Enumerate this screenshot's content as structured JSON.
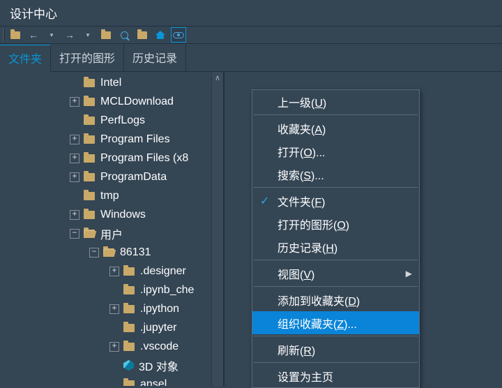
{
  "title": "设计中心",
  "tabs": [
    "文件夹",
    "打开的图形",
    "历史记录"
  ],
  "activeTab": 0,
  "tree": [
    {
      "ind": 100,
      "exp": "",
      "icon": "folder",
      "label": "Intel"
    },
    {
      "ind": 100,
      "exp": "+",
      "icon": "folder",
      "label": "MCLDownload"
    },
    {
      "ind": 100,
      "exp": "",
      "icon": "folder",
      "label": "PerfLogs"
    },
    {
      "ind": 100,
      "exp": "+",
      "icon": "folder",
      "label": "Program Files"
    },
    {
      "ind": 100,
      "exp": "+",
      "icon": "folder",
      "label": "Program Files (x8"
    },
    {
      "ind": 100,
      "exp": "+",
      "icon": "folder",
      "label": "ProgramData"
    },
    {
      "ind": 100,
      "exp": "",
      "icon": "folder",
      "label": "tmp"
    },
    {
      "ind": 100,
      "exp": "+",
      "icon": "folder",
      "label": "Windows"
    },
    {
      "ind": 100,
      "exp": "−",
      "icon": "folder-open",
      "label": "用户"
    },
    {
      "ind": 128,
      "exp": "−",
      "icon": "folder-open",
      "label": "86131"
    },
    {
      "ind": 157,
      "exp": "+",
      "icon": "folder",
      "label": ".designer"
    },
    {
      "ind": 157,
      "exp": "",
      "icon": "folder",
      "label": ".ipynb_che"
    },
    {
      "ind": 157,
      "exp": "+",
      "icon": "folder",
      "label": ".ipython"
    },
    {
      "ind": 157,
      "exp": "",
      "icon": "folder",
      "label": ".jupyter"
    },
    {
      "ind": 157,
      "exp": "+",
      "icon": "folder",
      "label": ".vscode"
    },
    {
      "ind": 157,
      "exp": "",
      "icon": "cube",
      "label": "3D 对象"
    },
    {
      "ind": 157,
      "exp": "",
      "icon": "folder",
      "label": "ansel"
    }
  ],
  "context": [
    {
      "t": "item",
      "label": "上一级(<u>U</u>)"
    },
    {
      "t": "sep"
    },
    {
      "t": "item",
      "label": "收藏夹(<u>A</u>)"
    },
    {
      "t": "item",
      "label": "打开(<u>O</u>)..."
    },
    {
      "t": "item",
      "label": "搜索(<u>S</u>)..."
    },
    {
      "t": "sep"
    },
    {
      "t": "item",
      "label": "文件夹(<u>F</u>)",
      "chk": true
    },
    {
      "t": "item",
      "label": "打开的图形(<u>O</u>)"
    },
    {
      "t": "item",
      "label": "历史记录(<u>H</u>)"
    },
    {
      "t": "sep"
    },
    {
      "t": "item",
      "label": "视图(<u>V</u>)",
      "sub": true
    },
    {
      "t": "sep"
    },
    {
      "t": "item",
      "label": "添加到收藏夹(<u>D</u>)"
    },
    {
      "t": "item",
      "label": "组织收藏夹(<u>Z</u>)...",
      "hl": true
    },
    {
      "t": "sep"
    },
    {
      "t": "item",
      "label": "刷新(<u>R</u>)"
    },
    {
      "t": "sep"
    },
    {
      "t": "item",
      "label": "设置为主页"
    }
  ]
}
